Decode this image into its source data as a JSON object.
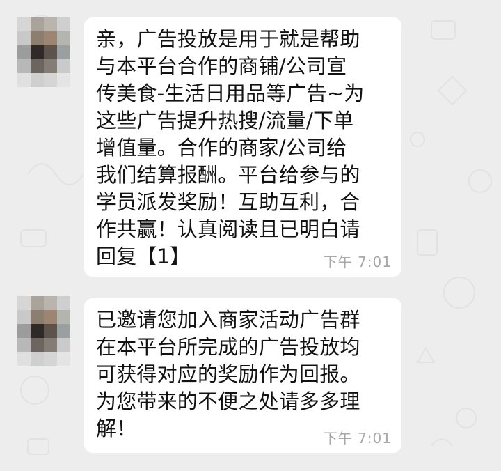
{
  "chat": {
    "messages": [
      {
        "lines": [
          "亲，广告投放是用于就是帮助",
          "与本平台合作的商铺/公司宣",
          "传美食-生活日用品等广告~为",
          "这些广告提升热搜/流量/下单",
          "增值量。合作的商家/公司给",
          "我们结算报酬。平台给参与的",
          "学员派发奖励！互助互利，合",
          "作共赢！认真阅读且已明白请",
          "回复【1】"
        ],
        "time": "下午 7:01"
      },
      {
        "lines": [
          "已邀请您加入商家活动广告群",
          "在本平台所完成的广告投放均",
          "可获得对应的奖励作为回报。",
          "为您带来的不便之处请多多理",
          "解！"
        ],
        "time": "下午 7:01"
      }
    ]
  },
  "colors": {
    "background": "#ededed",
    "bubble": "#ffffff",
    "text": "#121212",
    "timestamp": "#a8a8a8"
  }
}
